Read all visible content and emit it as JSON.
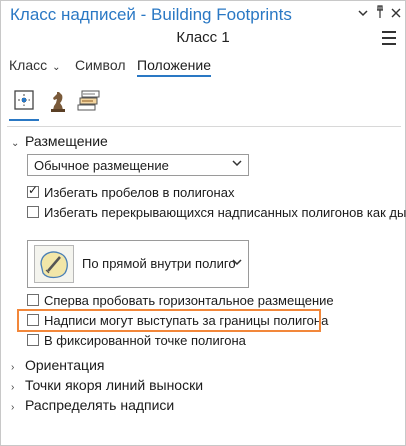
{
  "window": {
    "title": "Класс надписей - Building Footprints",
    "subtitle": "Класс 1",
    "buttons": {
      "dropdown": "▾",
      "pin": "ᵖ",
      "close": "✕"
    }
  },
  "tabs": {
    "class_label": "Класс",
    "symbol_label": "Символ",
    "position_label": "Положение"
  },
  "icon_tabs": [
    "placement-icon",
    "chess-knight-icon",
    "conflict-resolution-icon"
  ],
  "placement": {
    "header": "Размещение",
    "dropdown_value": "Обычное размещение",
    "checkboxes": [
      {
        "label": "Избегать пробелов в полигонах",
        "checked": true
      },
      {
        "label": "Избегать перекрывающихся надписанных полигонов как дыр",
        "checked": false
      }
    ],
    "position_picker_label": "По прямой внутри полиго",
    "checkboxes2": [
      {
        "label": "Сперва пробовать горизонтальное размещение",
        "checked": false
      },
      {
        "label": "Надписи могут выступать за границы полигона",
        "checked": false
      },
      {
        "label": "В фиксированной точке полигона",
        "checked": false
      }
    ]
  },
  "sections": {
    "orientation": "Ориентация",
    "leader_anchor": "Точки якоря линий выноски",
    "spread_labels": "Распределять надписи"
  },
  "colors": {
    "accent": "#2a78c4",
    "highlight": "#f2873a"
  }
}
